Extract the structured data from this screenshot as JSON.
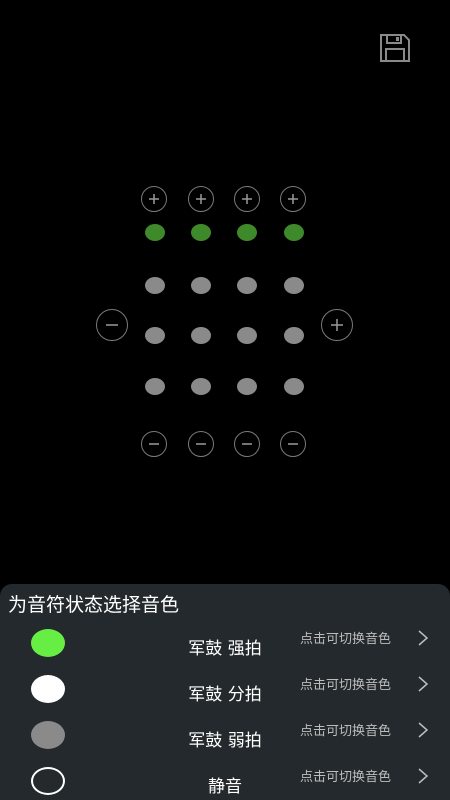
{
  "toolbar": {
    "save_icon": "save-icon"
  },
  "grid": {
    "columns": 4,
    "rows": [
      {
        "state": "accent",
        "color": "#3e8a2a"
      },
      {
        "state": "normal",
        "color": "#8a8a8a"
      },
      {
        "state": "normal",
        "color": "#8a8a8a"
      },
      {
        "state": "normal",
        "color": "#8a8a8a"
      }
    ],
    "column_plus_icon": "plus-icon",
    "column_minus_icon": "minus-icon",
    "row_add_icon": "plus-icon",
    "row_remove_icon": "minus-icon"
  },
  "panel": {
    "title": "为音符状态选择音色",
    "items": [
      {
        "label": "军鼓 强拍",
        "hint": "点击可切换音色",
        "swatch_color": "#66ee44",
        "swatch_style": "filled"
      },
      {
        "label": "军鼓 分拍",
        "hint": "点击可切换音色",
        "swatch_color": "#ffffff",
        "swatch_style": "filled"
      },
      {
        "label": "军鼓 弱拍",
        "hint": "点击可切换音色",
        "swatch_color": "#8a8a8a",
        "swatch_style": "filled"
      },
      {
        "label": "静音",
        "hint": "点击可切换音色",
        "swatch_color": "#ffffff",
        "swatch_style": "outline"
      }
    ]
  },
  "colors": {
    "background": "#000000",
    "panel_background": "#23292c",
    "control_stroke": "#7a7a7a"
  }
}
